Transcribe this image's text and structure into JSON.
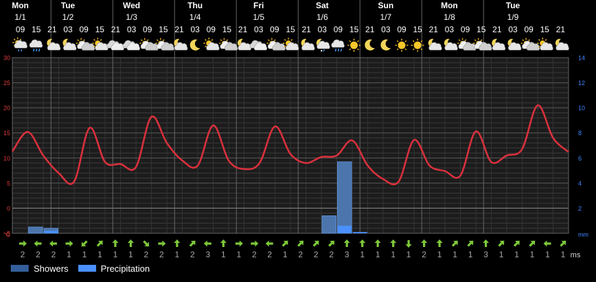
{
  "chart_data": {
    "type": "line",
    "days": [
      {
        "name": "Mon",
        "date": "1/1"
      },
      {
        "name": "Tue",
        "date": "1/2"
      },
      {
        "name": "Wed",
        "date": "1/3"
      },
      {
        "name": "Thu",
        "date": "1/4"
      },
      {
        "name": "Fri",
        "date": "1/5"
      },
      {
        "name": "Sat",
        "date": "1/6"
      },
      {
        "name": "Sun",
        "date": "1/7"
      },
      {
        "name": "Mon",
        "date": "1/8"
      },
      {
        "name": "Tue",
        "date": "1/9"
      }
    ],
    "day_start_index": [
      0,
      3,
      7,
      11,
      15,
      19,
      23,
      27,
      31
    ],
    "hours": [
      "09",
      "15",
      "21",
      "03",
      "09",
      "15",
      "21",
      "03",
      "09",
      "15",
      "21",
      "03",
      "09",
      "15",
      "21",
      "03",
      "09",
      "15",
      "21",
      "03",
      "09",
      "15",
      "21",
      "03",
      "09",
      "15",
      "21",
      "03",
      "09",
      "15",
      "21",
      "03",
      "09",
      "15",
      "21"
    ],
    "icons": [
      "partly-cloudy-drizzle",
      "cloudy-drizzle",
      "moon-cloud",
      "moon-cloud",
      "partly-cloudy",
      "sun-cloud",
      "cloudy",
      "cloudy",
      "partly-cloudy",
      "partly-cloudy",
      "moon-cloud",
      "moon",
      "sun-cloud",
      "partly-cloudy",
      "moon-cloud",
      "cloudy",
      "partly-cloudy",
      "sun-cloud",
      "moon-cloud",
      "moon-cloud-sleet",
      "cloudy-rain",
      "sun",
      "moon",
      "moon",
      "sun",
      "sun",
      "moon-cloud",
      "moon-cloud",
      "partly-cloudy",
      "partly-cloudy",
      "moon-cloud",
      "moon-cloud",
      "partly-cloudy",
      "sun-cloud",
      "moon-cloud"
    ],
    "temperature": [
      11.3,
      15.2,
      10.5,
      7,
      5.3,
      16,
      9.2,
      8.8,
      8.2,
      18.2,
      13,
      9.5,
      8.5,
      16.5,
      9.5,
      7.8,
      9,
      16.3,
      10.8,
      9,
      10.2,
      10.5,
      13.5,
      8.5,
      5.8,
      5.3,
      13.6,
      8.5,
      7.4,
      6.5,
      15.3,
      9.2,
      10.5,
      11.8,
      20.5,
      14,
      11.2
    ],
    "showers_mm": [
      0,
      0.5,
      0.4,
      0,
      0,
      0,
      0,
      0,
      0,
      0,
      0,
      0,
      0,
      0,
      0,
      0,
      0,
      0,
      0,
      0,
      1.4,
      5.7,
      0,
      0,
      0,
      0,
      0,
      0,
      0,
      0,
      0,
      0,
      0,
      0,
      0,
      0
    ],
    "precipitation_mm": [
      0,
      0,
      0.2,
      0,
      0,
      0,
      0,
      0,
      0,
      0,
      0,
      0,
      0,
      0,
      0,
      0,
      0,
      0,
      0,
      0,
      0,
      0.6,
      0.1,
      0,
      0,
      0,
      0,
      0,
      0,
      0,
      0,
      0,
      0,
      0,
      0,
      0
    ],
    "wind_dir": [
      "E",
      "W",
      "W",
      "E",
      "SW",
      "NE",
      "N",
      "N",
      "SE",
      "E",
      "N",
      "NE",
      "W",
      "N",
      "E",
      "E",
      "W",
      "NE",
      "NE",
      "NE",
      "NE",
      "N",
      "N",
      "N",
      "N",
      "S",
      "N",
      "N",
      "NE",
      "NE",
      "N",
      "NE",
      "NE",
      "NE",
      "W",
      "NE"
    ],
    "wind_ms": [
      "2",
      "2",
      "2",
      "1",
      "1",
      "1",
      "1",
      "1",
      "2",
      "2",
      "1",
      "2",
      "3",
      "1",
      "1",
      "2",
      "2",
      "1",
      "2",
      "2",
      "2",
      "3",
      "1",
      "1",
      "1",
      "1",
      "2",
      "1",
      "1",
      "1",
      "3",
      "1",
      "1",
      "1",
      "1",
      "1"
    ],
    "wind_unit": "ms",
    "y_left_ticks": [
      "30",
      "25",
      "20",
      "15",
      "10",
      "5",
      "0",
      "-5"
    ],
    "y_left_unit": "°C",
    "y_left_range": [
      -5,
      30
    ],
    "y_right_ticks": [
      "14",
      "12",
      "10",
      "8",
      "6",
      "4",
      "2"
    ],
    "y_right_unit": "mm",
    "y_right_range": [
      0,
      14
    ],
    "temp_color": "#d8303c",
    "precip_color": "#4a90ff",
    "axis_left_color": "#e03a3a",
    "axis_right_color": "#3f86ff",
    "grid": true,
    "legend": {
      "showers": "Showers",
      "precipitation": "Precipitation"
    }
  }
}
